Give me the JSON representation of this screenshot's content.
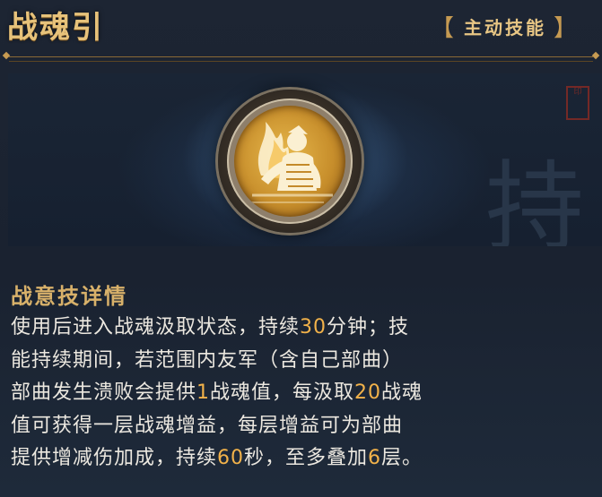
{
  "header": {
    "title": "战魂引",
    "tag_left": "【",
    "tag_label": "主动技能",
    "tag_right": "】"
  },
  "scene": {
    "skill_icon": "warrior-flame-icon",
    "seal_text": "印",
    "calligraphy_text": "持"
  },
  "details": {
    "section_title": "战意技详情",
    "lines": [
      [
        {
          "t": "使用后进入战魂汲取状态，持续"
        },
        {
          "t": "30",
          "hl": true
        },
        {
          "t": "分钟；技"
        }
      ],
      [
        {
          "t": "能持续期间，若范围内友军（含自己部曲）"
        }
      ],
      [
        {
          "t": "部曲发生溃败会提供"
        },
        {
          "t": "1",
          "hl": true
        },
        {
          "t": "战魂值，每汲取"
        },
        {
          "t": "20",
          "hl": true
        },
        {
          "t": "战魂"
        }
      ],
      [
        {
          "t": "值可获得一层战魂增益，每层增益可为部曲"
        }
      ],
      [
        {
          "t": "提供增减伤加成，持续"
        },
        {
          "t": "60",
          "hl": true
        },
        {
          "t": "秒，至多叠加"
        },
        {
          "t": "6",
          "hl": true
        },
        {
          "t": "层。"
        }
      ]
    ]
  },
  "colors": {
    "title": "#e7c27a",
    "highlight": "#f2b24a",
    "body_text": "#ece8e0"
  }
}
